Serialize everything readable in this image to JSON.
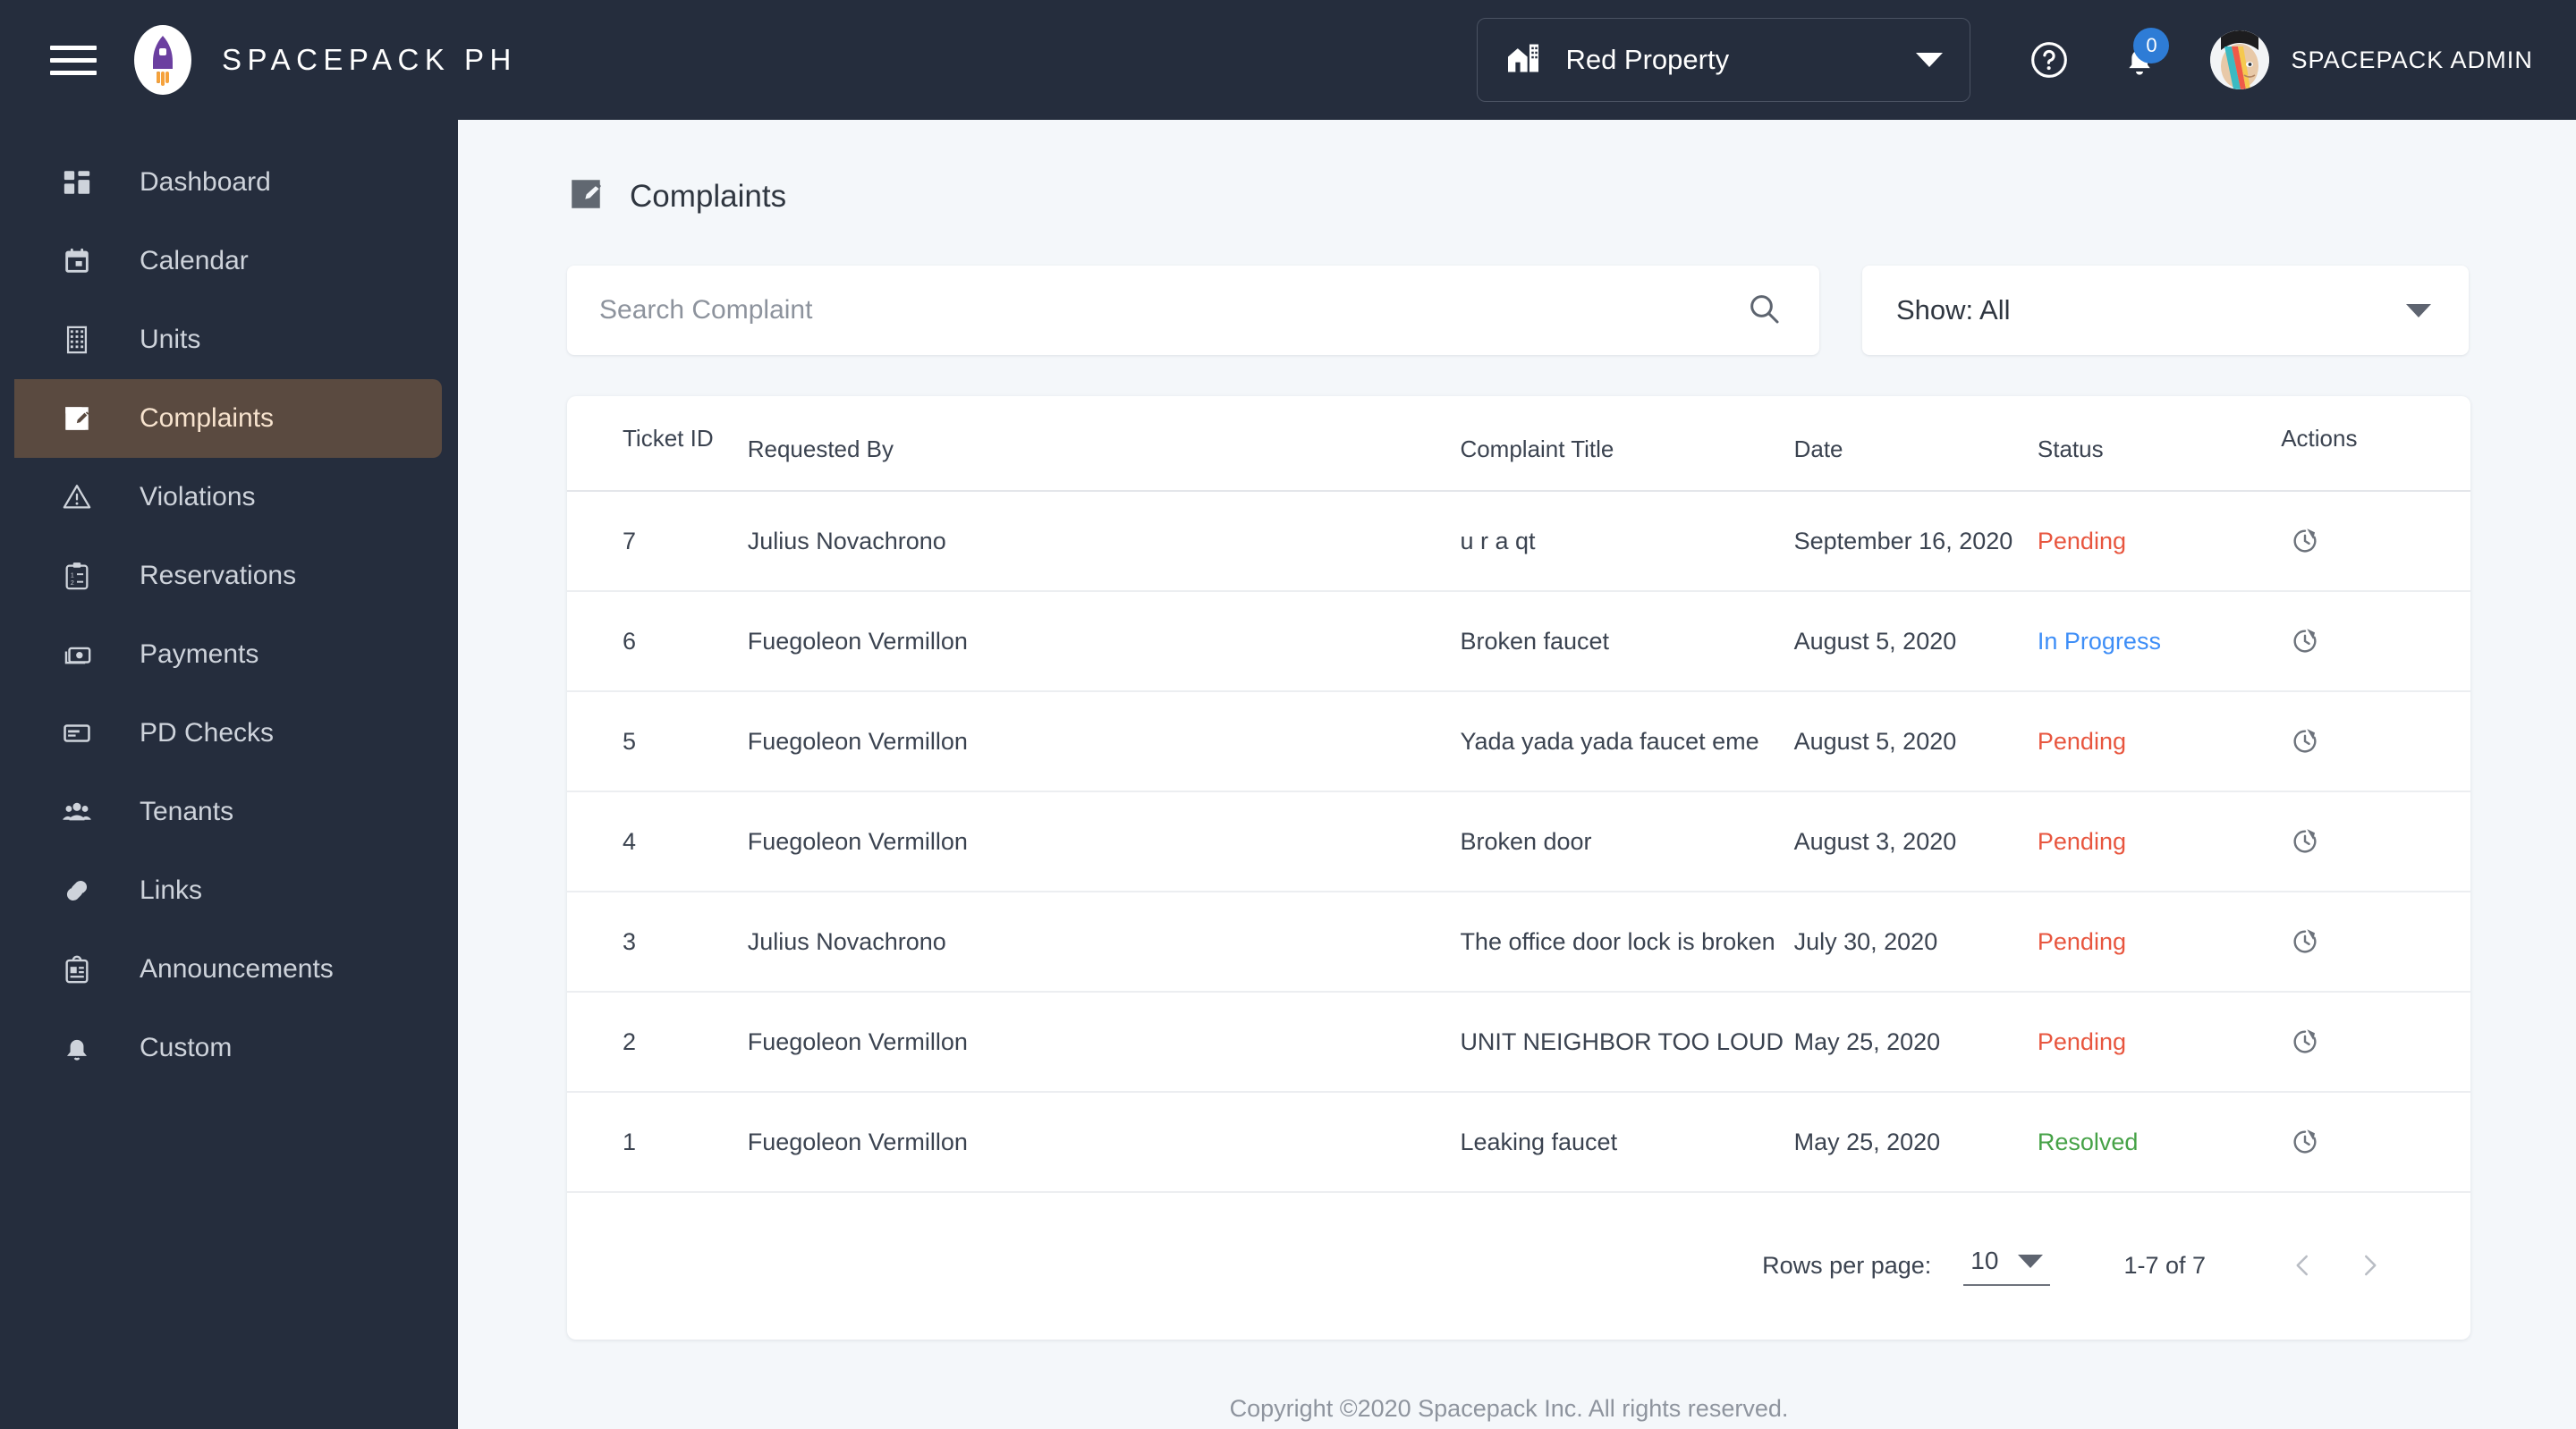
{
  "header": {
    "menu_icon": "hamburger-menu-icon",
    "logo_icon": "rocket-logo-icon",
    "brand": "SPACEPACK PH",
    "property": {
      "icon": "home-work-icon",
      "value": "Red Property",
      "caret_icon": "chevron-down-icon"
    },
    "help_icon": "help-circle-icon",
    "notifications": {
      "icon": "bell-icon",
      "count": "0",
      "badge_color": "#2e7cd6"
    },
    "user": {
      "avatar_icon": "user-avatar",
      "name": "SPACEPACK ADMIN"
    }
  },
  "sidebar": {
    "items": [
      {
        "label": "Dashboard",
        "icon": "dashboard-icon",
        "active": false
      },
      {
        "label": "Calendar",
        "icon": "calendar-icon",
        "active": false
      },
      {
        "label": "Units",
        "icon": "building-icon",
        "active": false
      },
      {
        "label": "Complaints",
        "icon": "complaint-edit-icon",
        "active": true
      },
      {
        "label": "Violations",
        "icon": "warning-icon",
        "active": false
      },
      {
        "label": "Reservations",
        "icon": "clipboard-list-icon",
        "active": false
      },
      {
        "label": "Payments",
        "icon": "money-icon",
        "active": false
      },
      {
        "label": "PD Checks",
        "icon": "check-card-icon",
        "active": false
      },
      {
        "label": "Tenants",
        "icon": "people-icon",
        "active": false
      },
      {
        "label": "Links",
        "icon": "link-icon",
        "active": false
      },
      {
        "label": "Announcements",
        "icon": "announcement-icon",
        "active": false
      },
      {
        "label": "Custom",
        "icon": "bell-outline-icon",
        "active": false
      }
    ],
    "active_bg": "#5a4a40",
    "active_text": "#f7e3ce"
  },
  "main": {
    "page_icon": "complaint-edit-icon",
    "page_title": "Complaints",
    "search": {
      "placeholder": "Search Complaint",
      "value": "",
      "icon": "search-icon"
    },
    "show_filter": {
      "label": "Show: All",
      "caret_icon": "chevron-down-icon"
    },
    "table": {
      "columns": [
        "Ticket ID",
        "Requested By",
        "Complaint Title",
        "Date",
        "Status",
        "Actions"
      ],
      "rows": [
        {
          "ticket_id": "7",
          "requested_by": "Julius Novachrono",
          "title": "u r a qt",
          "date": "September 16, 2020",
          "status": "Pending",
          "status_class": "st-pending",
          "action_icon": "history-update-icon"
        },
        {
          "ticket_id": "6",
          "requested_by": "Fuegoleon Vermillon",
          "title": "Broken faucet",
          "date": "August 5, 2020",
          "status": "In Progress",
          "status_class": "st-progress",
          "action_icon": "history-update-icon"
        },
        {
          "ticket_id": "5",
          "requested_by": "Fuegoleon Vermillon",
          "title": "Yada yada yada faucet eme",
          "date": "August 5, 2020",
          "status": "Pending",
          "status_class": "st-pending",
          "action_icon": "history-update-icon"
        },
        {
          "ticket_id": "4",
          "requested_by": "Fuegoleon Vermillon",
          "title": "Broken door",
          "date": "August 3, 2020",
          "status": "Pending",
          "status_class": "st-pending",
          "action_icon": "history-update-icon"
        },
        {
          "ticket_id": "3",
          "requested_by": "Julius Novachrono",
          "title": "The office door lock is broken",
          "date": "July 30, 2020",
          "status": "Pending",
          "status_class": "st-pending",
          "action_icon": "history-update-icon"
        },
        {
          "ticket_id": "2",
          "requested_by": "Fuegoleon Vermillon",
          "title": "UNIT NEIGHBOR TOO LOUD",
          "date": "May 25, 2020",
          "status": "Pending",
          "status_class": "st-pending",
          "action_icon": "history-update-icon"
        },
        {
          "ticket_id": "1",
          "requested_by": "Fuegoleon Vermillon",
          "title": "Leaking faucet",
          "date": "May 25, 2020",
          "status": "Resolved",
          "status_class": "st-resolved",
          "action_icon": "history-update-icon"
        }
      ]
    },
    "pagination": {
      "rows_per_page_label": "Rows per page:",
      "rows_per_page_value": "10",
      "range": "1-7 of 7",
      "prev_icon": "chevron-left-icon",
      "next_icon": "chevron-right-icon"
    }
  },
  "footer": {
    "copyright": "Copyright ©2020 Spacepack Inc. All rights reserved."
  },
  "colors": {
    "sidebar_bg": "#252d3d",
    "page_bg": "#f4f7fa",
    "status_pending": "#e8563f",
    "status_in_progress": "#3e8ef7",
    "status_resolved": "#46a247",
    "accent_active": "#5a4a40"
  }
}
